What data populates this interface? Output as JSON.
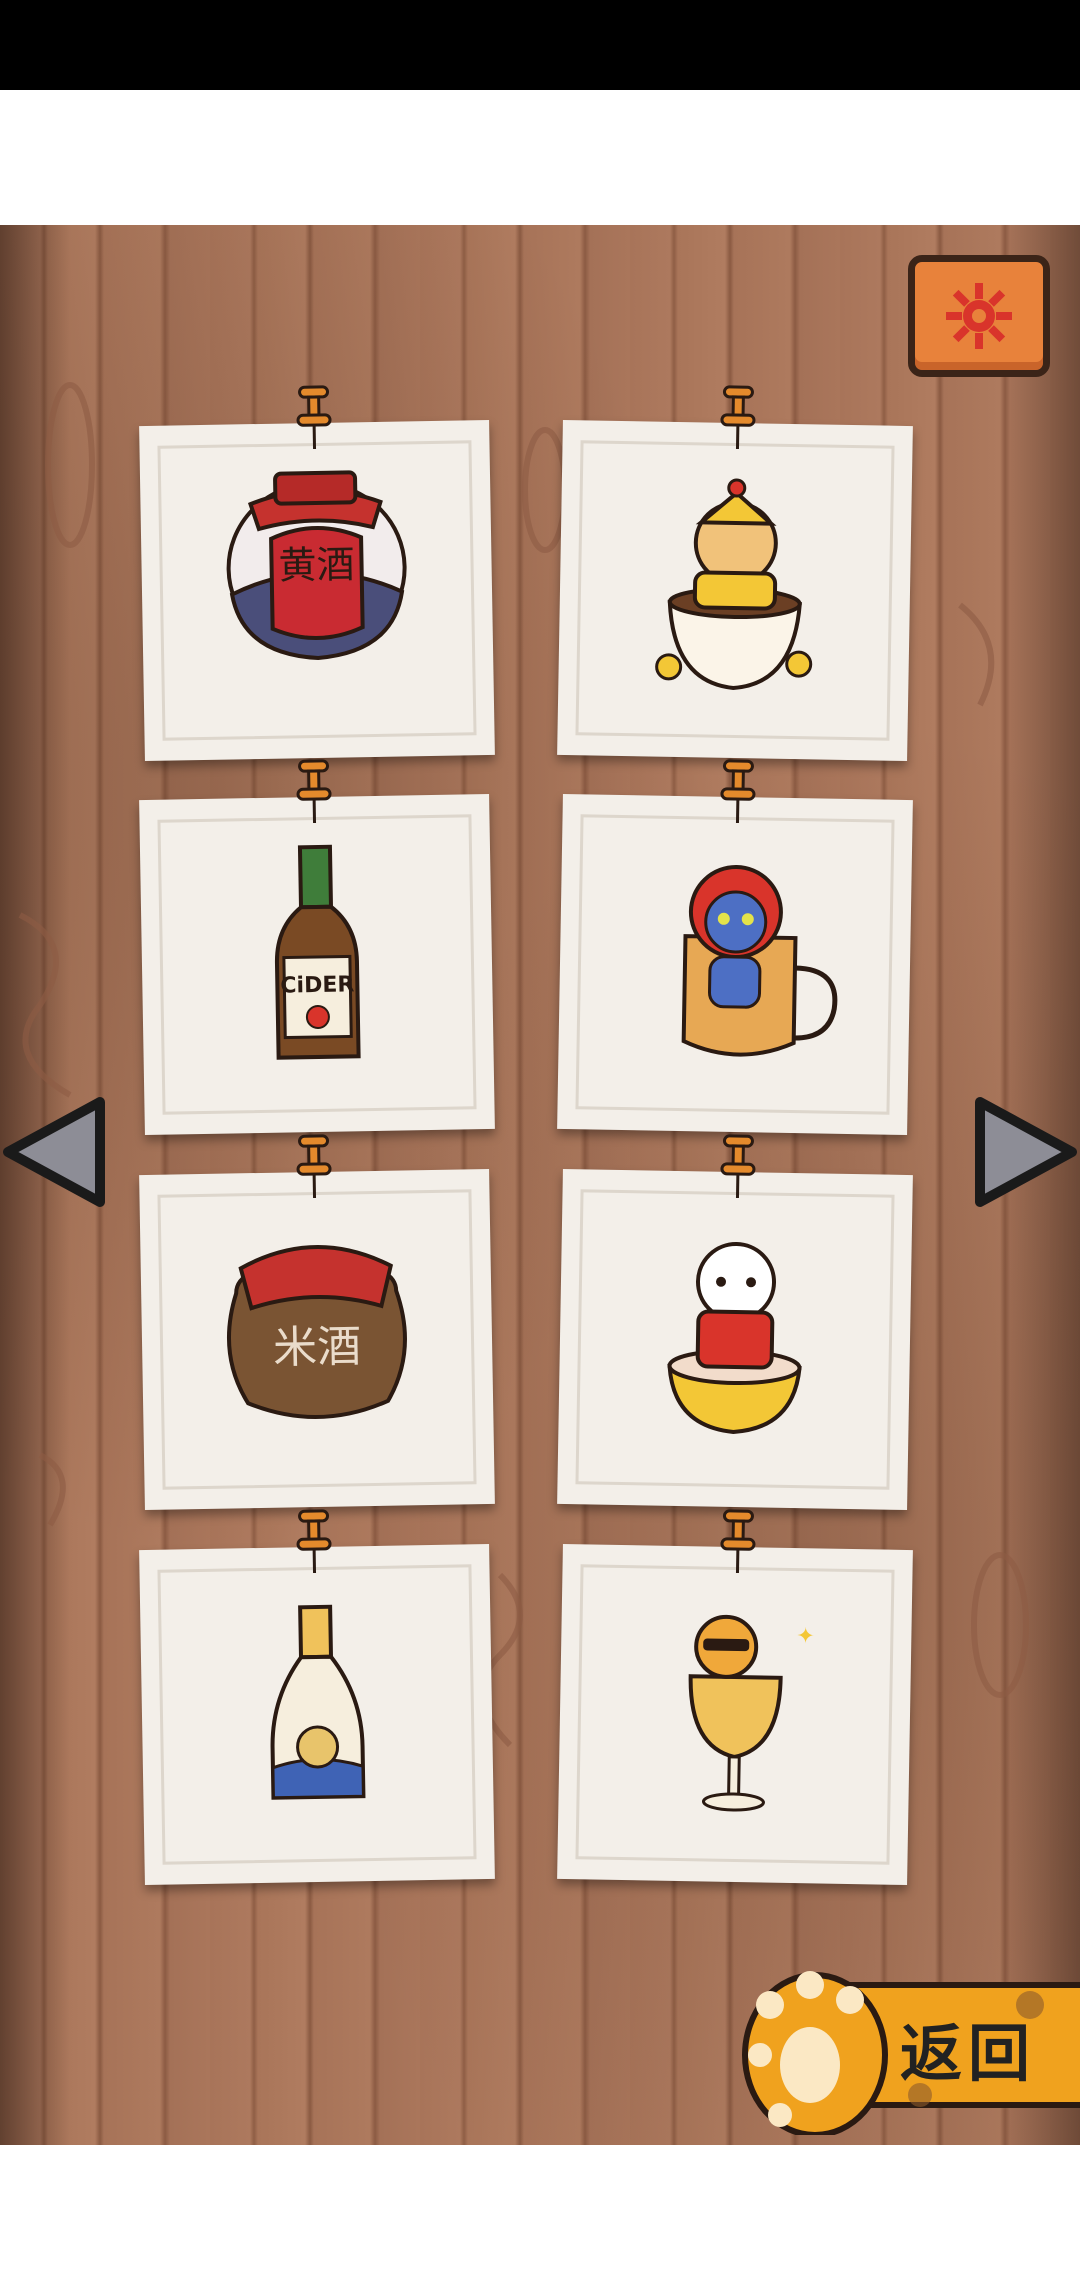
{
  "settings": {
    "icon": "gear-icon"
  },
  "cards": [
    {
      "name": "yellow-wine-jar-card",
      "label": "黄酒",
      "icon": "yellow-wine-jar-icon"
    },
    {
      "name": "fortune-cat-cup-card",
      "icon": "fortune-cat-in-cup-icon"
    },
    {
      "name": "cider-bottle-card",
      "label": "CiDER",
      "icon": "cider-bottle-icon"
    },
    {
      "name": "apple-cat-mug-card",
      "icon": "apple-hat-cat-mug-icon"
    },
    {
      "name": "rice-wine-jar-card",
      "label": "米酒",
      "icon": "rice-wine-jar-icon"
    },
    {
      "name": "red-jacket-cat-bowl-card",
      "icon": "red-jacket-cat-bowl-icon"
    },
    {
      "name": "rabbit-bottle-card",
      "icon": "rabbit-label-bottle-icon"
    },
    {
      "name": "sunglasses-cat-glass-card",
      "icon": "sunglasses-cat-glass-icon"
    }
  ],
  "nav": {
    "prev_icon": "left-triangle-icon",
    "next_icon": "right-triangle-icon"
  },
  "back_button": {
    "label": "返回",
    "icon": "cat-paw-icon"
  },
  "colors": {
    "wood": "#a87459",
    "card": "#f3efe9",
    "accent": "#e8823b",
    "paw": "#f0a21e"
  }
}
